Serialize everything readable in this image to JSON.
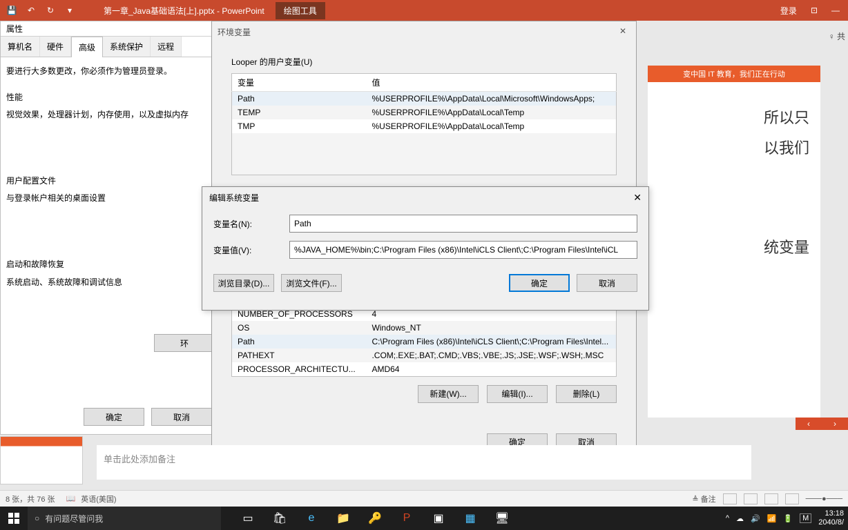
{
  "powerpoint": {
    "filename": "第一章_Java基础语法[上].pptx - PowerPoint",
    "drawing_tools": "绘图工具",
    "login": "登录",
    "share": "共",
    "notes_placeholder": "单击此处添加备注",
    "status_slides": "8 张，共 76 张",
    "status_lang": "英语(美国)",
    "status_notes": "备注"
  },
  "slide": {
    "banner": "变中国 IT 教育，我们正在行动",
    "line1": "所以只",
    "line2": "以我们",
    "line3": "统变量"
  },
  "props": {
    "title": "属性",
    "tabs": [
      "算机名",
      "硬件",
      "高级",
      "系统保护",
      "远程"
    ],
    "admin_note": "要进行大多数更改，你必须作为管理员登录。",
    "perf_title": "性能",
    "perf_desc": "视觉效果，处理器计划，内存使用，以及虚拟内存",
    "profile_title": "用户配置文件",
    "profile_desc": "与登录帐户相关的桌面设置",
    "startup_title": "启动和故障恢复",
    "startup_desc": "系统启动、系统故障和调试信息",
    "env_btn": "环",
    "ok": "确定",
    "cancel": "取消"
  },
  "env": {
    "title": "环境变量",
    "user_label": "Looper 的用户变量(U)",
    "col_var": "变量",
    "col_val": "值",
    "user_rows": [
      {
        "k": "Path",
        "v": "%USERPROFILE%\\AppData\\Local\\Microsoft\\WindowsApps;"
      },
      {
        "k": "TEMP",
        "v": "%USERPROFILE%\\AppData\\Local\\Temp"
      },
      {
        "k": "TMP",
        "v": "%USERPROFILE%\\AppData\\Local\\Temp"
      }
    ],
    "sys_rows": [
      {
        "k": "NUMBER_OF_PROCESSORS",
        "v": "4"
      },
      {
        "k": "OS",
        "v": "Windows_NT"
      },
      {
        "k": "Path",
        "v": "C:\\Program Files (x86)\\Intel\\iCLS Client\\;C:\\Program Files\\Intel..."
      },
      {
        "k": "PATHEXT",
        "v": ".COM;.EXE;.BAT;.CMD;.VBS;.VBE;.JS;.JSE;.WSF;.WSH;.MSC"
      },
      {
        "k": "PROCESSOR_ARCHITECTU...",
        "v": "AMD64"
      }
    ],
    "new_btn": "新建(W)...",
    "edit_btn": "编辑(I)...",
    "delete_btn": "删除(L)",
    "ok": "确定",
    "cancel": "取消"
  },
  "edit": {
    "title": "编辑系统变量",
    "name_label": "变量名(N):",
    "name_value": "Path",
    "value_label": "变量值(V):",
    "value_value": "%JAVA_HOME%\\bin;C:\\Program Files (x86)\\Intel\\iCLS Client\\;C:\\Program Files\\Intel\\iCL",
    "browse_dir": "浏览目录(D)...",
    "browse_file": "浏览文件(F)...",
    "ok": "确定",
    "cancel": "取消"
  },
  "taskbar": {
    "search": "有问题尽管问我",
    "time": "13:18",
    "date": "2040/8/",
    "ime": "M"
  }
}
